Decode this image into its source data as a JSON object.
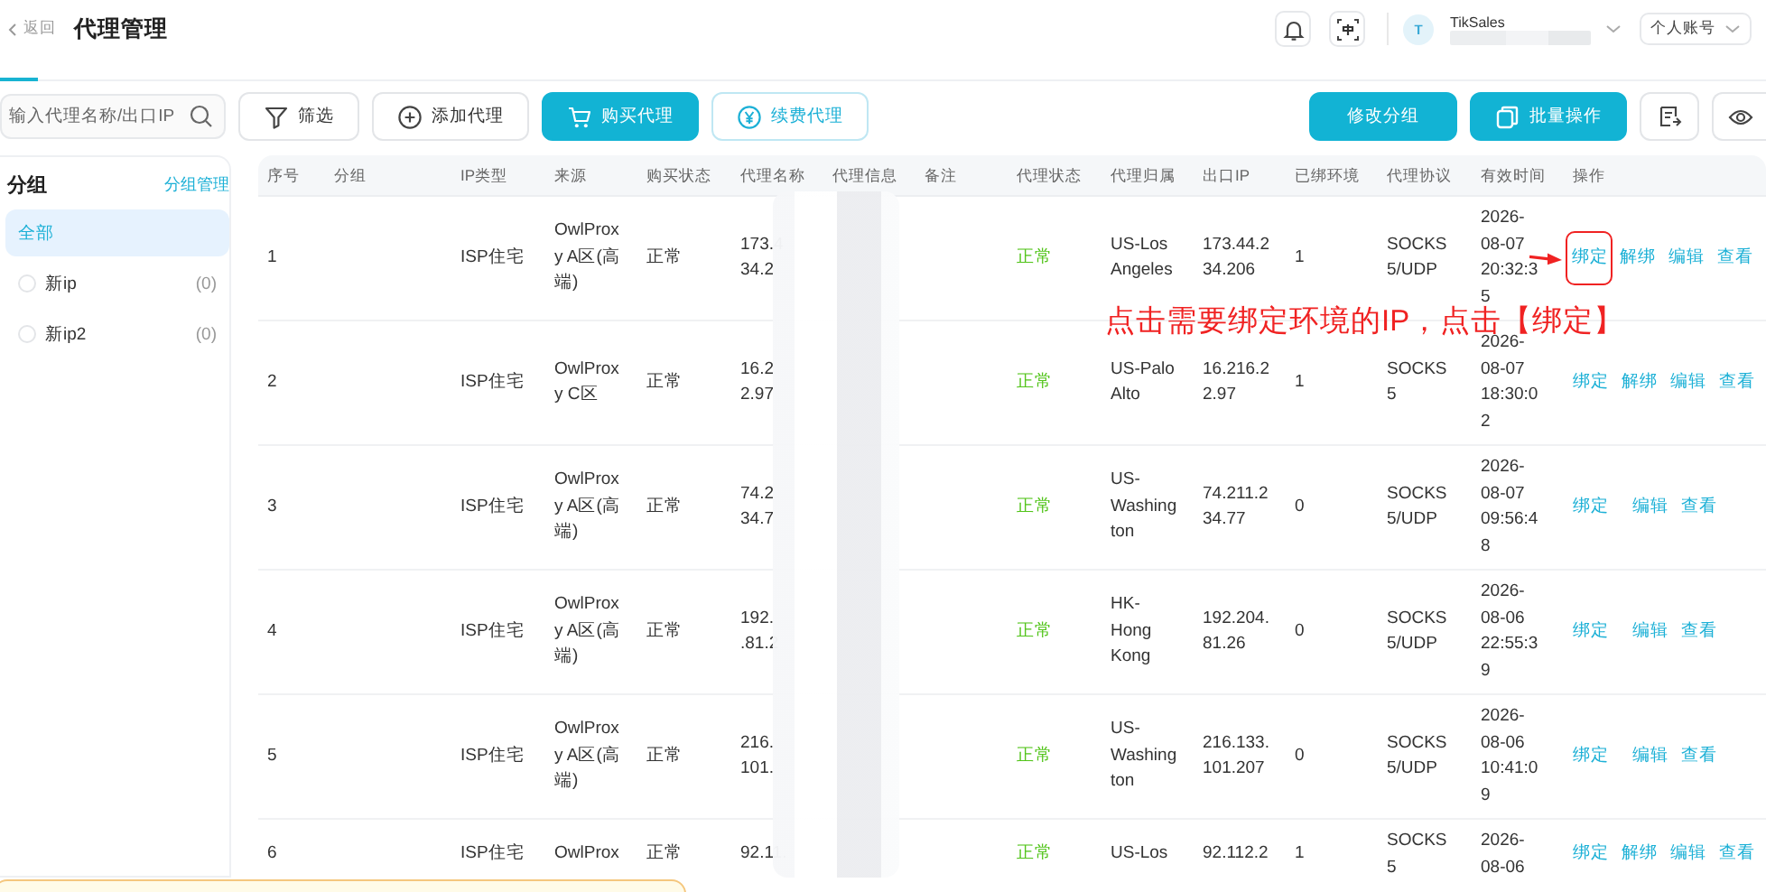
{
  "header": {
    "back": "返回",
    "title": "代理管理",
    "user": {
      "avatar": "T",
      "name": "TikSales"
    },
    "account_menu": "个人账号"
  },
  "toolbar": {
    "search": {
      "placeholder": "输入代理名称/出口IP"
    },
    "left_buttons": [
      {
        "label": "筛选",
        "kind": "filter"
      },
      {
        "label": "添加代理",
        "kind": "add"
      },
      {
        "label": "购买代理",
        "kind": "buy"
      },
      {
        "label": "续费代理",
        "kind": "renew"
      }
    ],
    "right_buttons": [
      {
        "label": "修改分组",
        "kind": "group"
      },
      {
        "label": "批量操作",
        "kind": "batch"
      }
    ]
  },
  "sidebar": {
    "title": "分组",
    "manage_link": "分组管理",
    "items": [
      {
        "label": "全部",
        "selected": true
      },
      {
        "label": "新ip",
        "count": "(0)",
        "selected": false
      },
      {
        "label": "新ip2",
        "count": "(0)",
        "selected": false
      }
    ]
  },
  "table": {
    "columns": [
      "序号",
      "分组",
      "IP类型",
      "来源",
      "购买状态",
      "代理名称",
      "代理信息",
      "备注",
      "代理状态",
      "代理归属",
      "出口IP",
      "已绑环境",
      "代理协议",
      "有效时间",
      "操作"
    ],
    "rows": [
      {
        "index": "1",
        "ip_type": "ISP住宅",
        "source": "OwlProxy A区(高端)",
        "purchase_status": "正常",
        "proxy_name": "173.4 34.2",
        "status": {
          "text": "正常",
          "ok": true
        },
        "location": "US-Los Angeles",
        "exit_ip": "173.44.234.206",
        "bound_envs": "1",
        "protocol": "SOCKS5/UDP",
        "expiry": "2026-08-07 20:32:35",
        "actions": [
          {
            "label": "绑定",
            "kind": "bind",
            "highlighted": true
          },
          {
            "label": "解绑",
            "kind": "unbind",
            "highlighted": false
          },
          {
            "label": "编辑",
            "kind": "edit",
            "highlighted": false
          },
          {
            "label": "查看",
            "kind": "view",
            "highlighted": false
          }
        ]
      },
      {
        "index": "2",
        "ip_type": "ISP住宅",
        "source": "OwlProxy C区",
        "purchase_status": "正常",
        "proxy_name": "16.2 2.97",
        "status": {
          "text": "正常",
          "ok": true
        },
        "location": "US-Palo Alto",
        "exit_ip": "16.216.22.97",
        "bound_envs": "1",
        "protocol": "SOCKS5",
        "expiry": "2026-08-07 18:30:02",
        "actions": [
          {
            "label": "绑定",
            "kind": "bind",
            "highlighted": false
          },
          {
            "label": "解绑",
            "kind": "unbind",
            "highlighted": false
          },
          {
            "label": "编辑",
            "kind": "edit",
            "highlighted": false
          },
          {
            "label": "查看",
            "kind": "view",
            "highlighted": false
          }
        ]
      },
      {
        "index": "3",
        "ip_type": "ISP住宅",
        "source": "OwlProxy A区(高端)",
        "purchase_status": "正常",
        "proxy_name": "74.2 34.7",
        "status": {
          "text": "正常",
          "ok": true
        },
        "location": "US-Washington",
        "exit_ip": "74.211.234.77",
        "bound_envs": "0",
        "protocol": "SOCKS5/UDP",
        "expiry": "2026-08-07 09:56:48",
        "actions": [
          {
            "label": "绑定",
            "kind": "bind",
            "highlighted": false
          },
          {
            "label": "编辑",
            "kind": "edit",
            "highlighted": false
          },
          {
            "label": "查看",
            "kind": "view",
            "highlighted": false
          }
        ]
      },
      {
        "index": "4",
        "ip_type": "ISP住宅",
        "source": "OwlProxy A区(高端)",
        "purchase_status": "正常",
        "proxy_name": "192. .81.2",
        "status": {
          "text": "正常",
          "ok": true
        },
        "location": "HK-Hong Kong",
        "exit_ip": "192.204.81.26",
        "bound_envs": "0",
        "protocol": "SOCKS5/UDP",
        "expiry": "2026-08-06 22:55:39",
        "actions": [
          {
            "label": "绑定",
            "kind": "bind",
            "highlighted": false
          },
          {
            "label": "编辑",
            "kind": "edit",
            "highlighted": false
          },
          {
            "label": "查看",
            "kind": "view",
            "highlighted": false
          }
        ]
      },
      {
        "index": "5",
        "ip_type": "ISP住宅",
        "source": "OwlProxy A区(高端)",
        "purchase_status": "正常",
        "proxy_name": "216. 101.",
        "status": {
          "text": "正常",
          "ok": true
        },
        "location": "US-Washington",
        "exit_ip": "216.133.101.207",
        "bound_envs": "0",
        "protocol": "SOCKS5/UDP",
        "expiry": "2026-08-06 10:41:09",
        "actions": [
          {
            "label": "绑定",
            "kind": "bind",
            "highlighted": false
          },
          {
            "label": "编辑",
            "kind": "edit",
            "highlighted": false
          },
          {
            "label": "查看",
            "kind": "view",
            "highlighted": false
          }
        ]
      },
      {
        "index": "6",
        "ip_type": "ISP住宅",
        "source": "OwlProx",
        "purchase_status": "正常",
        "proxy_name": "92.11.",
        "status": {
          "text": "正常",
          "ok": true
        },
        "location": "US-Los",
        "exit_ip": "92.112.2",
        "bound_envs": "1",
        "protocol": "SOCKS5",
        "expiry": "2026-08-06",
        "actions": [
          {
            "label": "绑定",
            "kind": "bind",
            "highlighted": false
          },
          {
            "label": "解绑",
            "kind": "unbind",
            "highlighted": false
          },
          {
            "label": "编辑",
            "kind": "edit",
            "highlighted": false
          },
          {
            "label": "查看",
            "kind": "view",
            "highlighted": false
          }
        ]
      }
    ]
  },
  "annotation": {
    "text": "点击需要绑定环境的IP，点击【绑定】"
  }
}
